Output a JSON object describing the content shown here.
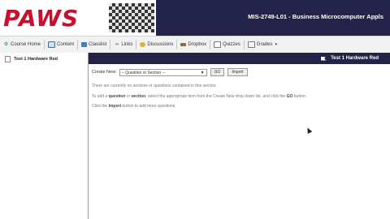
{
  "header": {
    "logo_text": "PAWS",
    "course_title": "MIS-2749-L01 - Business Microcomputer Appls",
    "colors": {
      "banner": "#23234a",
      "logo": "#c8102e"
    }
  },
  "nav": {
    "items": [
      {
        "label": "Course Home",
        "icon": "home-icon"
      },
      {
        "label": "Content",
        "icon": "content-icon"
      },
      {
        "label": "Classlist",
        "icon": "classlist-icon"
      },
      {
        "label": "Links",
        "icon": "links-icon"
      },
      {
        "label": "Discussions",
        "icon": "discussions-icon"
      },
      {
        "label": "Dropbox",
        "icon": "dropbox-icon"
      },
      {
        "label": "Quizzes",
        "icon": "quizzes-icon"
      },
      {
        "label": "Grades",
        "icon": "grades-icon"
      }
    ]
  },
  "sidebar": {
    "items": [
      {
        "label": "Test 1 Hardware Red"
      }
    ]
  },
  "main": {
    "title": "Test 1 Hardware Red",
    "create_label": "Create New:",
    "select_value": "-- Question or Section --",
    "go_label": "GO",
    "import_label": "Import",
    "msg1": "There are currently no sections or questions contained in this section.",
    "msg2_a": "To add a ",
    "msg2_b": "question",
    "msg2_c": " or ",
    "msg2_d": "section",
    "msg2_e": ", select the appropriate item from the Create New drop down list, and click the ",
    "msg2_f": "GO",
    "msg2_g": " button.",
    "msg3_a": "Click the ",
    "msg3_b": "Import",
    "msg3_c": " button to add more questions."
  }
}
